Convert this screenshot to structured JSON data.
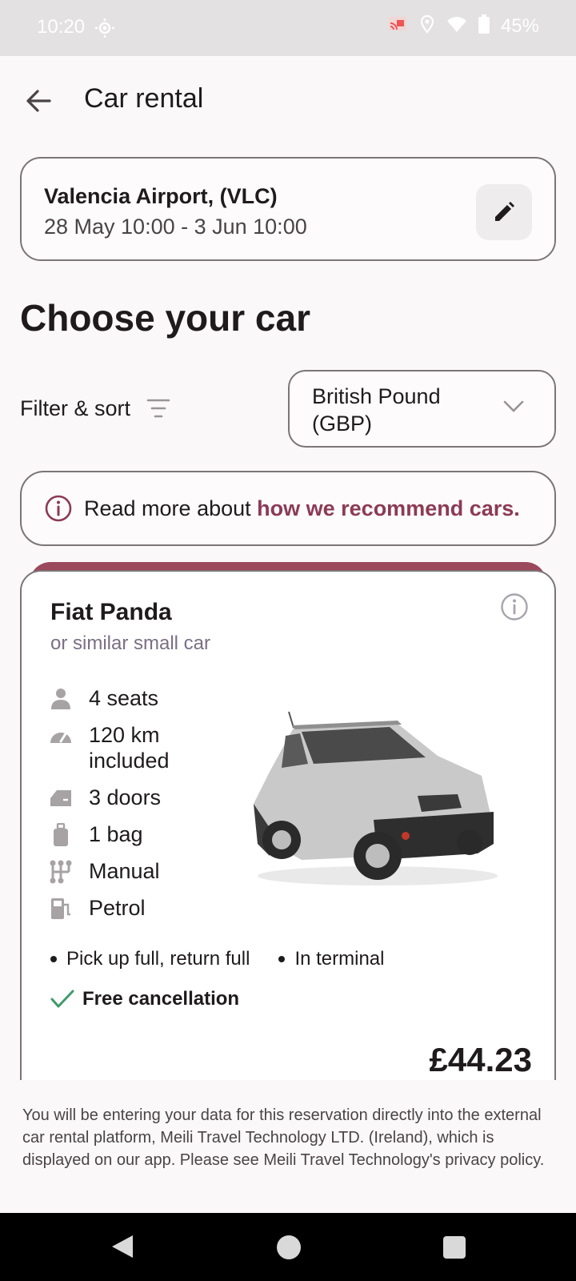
{
  "status_bar": {
    "time": "10:20",
    "battery": "45%",
    "icons": [
      "brightness-icon",
      "cast-icon",
      "location-icon",
      "wifi-icon",
      "battery-icon"
    ]
  },
  "app_bar": {
    "title": "Car rental",
    "back_icon": "arrow-back-icon"
  },
  "search": {
    "location": "Valencia Airport, (VLC)",
    "dates": "28 May 10:00 - 3 Jun 10:00",
    "edit_icon": "pencil-icon"
  },
  "section_title": "Choose your car",
  "filter": {
    "label": "Filter & sort",
    "icon": "filter-lines-icon"
  },
  "currency": {
    "selected": "British Pound (GBP)"
  },
  "info_banner": {
    "prefix": "Read more about ",
    "link": "how we recommend cars."
  },
  "car": {
    "name": "Fiat Panda",
    "subtitle": "or similar small car",
    "specs": [
      {
        "icon": "person-icon",
        "label": "4 seats"
      },
      {
        "icon": "speedometer-icon",
        "label": "120 km included"
      },
      {
        "icon": "car-door-icon",
        "label": "3 doors"
      },
      {
        "icon": "luggage-icon",
        "label": "1 bag"
      },
      {
        "icon": "gearshift-icon",
        "label": "Manual"
      },
      {
        "icon": "fuel-pump-icon",
        "label": "Petrol"
      }
    ],
    "bullets": [
      "Pick up full, return full",
      "In terminal"
    ],
    "cancellation": "Free cancellation",
    "price": "£44.23"
  },
  "disclaimer": "You will be entering your data for this reservation directly into the external car rental platform, Meili Travel Technology LTD. (Ireland), which is displayed on our app. Please see Meili Travel Technology's privacy policy.",
  "colors": {
    "accent": "#8c3b55",
    "card_accent": "#9a4a5c",
    "check": "#3f9a6c"
  }
}
